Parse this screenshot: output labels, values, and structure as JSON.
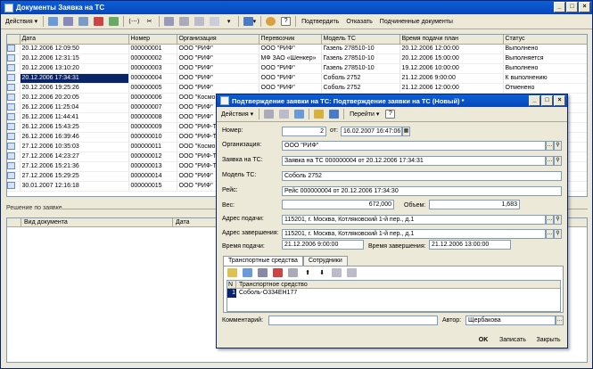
{
  "main": {
    "title": "Документы Заявка на ТС",
    "toolbar": {
      "actions_label": "Действия",
      "confirm_label": "Подтвердить",
      "refuse_label": "Отказать",
      "subordinate_label": "Подчиненные документы"
    },
    "columns": [
      "Дата",
      "Номер",
      "Организация",
      "Перевозчик",
      "Модель ТС",
      "Время подачи план",
      "Статус"
    ],
    "rows": [
      {
        "date": "20.12.2006 12:09:50",
        "num": "000000001",
        "org": "ООО \"РИФ\"",
        "carrier": "ООО \"РИФ\"",
        "model": "Газель 278510-10",
        "time": "20.12.2006 12:00:00",
        "status": "Выполнено"
      },
      {
        "date": "20.12.2006 12:31:15",
        "num": "000000002",
        "org": "ООО \"РИФ\"",
        "carrier": "МФ ЗАО «Шенкер»",
        "model": "Газель 278510-10",
        "time": "20.12.2006 15:00:00",
        "status": "Выполняется"
      },
      {
        "date": "20.12.2006 13:10:20",
        "num": "000000003",
        "org": "ООО \"РИФ\"",
        "carrier": "ООО \"РИФ\"",
        "model": "Газель 278510-10",
        "time": "19.12.2006 10:00:00",
        "status": "Выполнено"
      },
      {
        "date": "20.12.2006 17:34:31",
        "num": "000000004",
        "org": "ООО \"РИФ\"",
        "carrier": "ООО \"РИФ\"",
        "model": "Соболь 2752",
        "time": "21.12.2006 9:00:00",
        "status": "К выполнению"
      },
      {
        "date": "20.12.2006 19:25:26",
        "num": "000000005",
        "org": "ООО \"РИФ\"",
        "carrier": "ООО \"РИФ\"",
        "model": "Соболь 2752",
        "time": "21.12.2006 12:00:00",
        "status": "Отменено"
      },
      {
        "date": "20.12.2006 20:20:05",
        "num": "000000006",
        "org": "ООО \"Космо",
        "carrier": "",
        "model": "",
        "time": "",
        "status": ""
      },
      {
        "date": "26.12.2006 11:25:04",
        "num": "000000007",
        "org": "ООО \"РИФ\"",
        "carrier": "",
        "model": "",
        "time": "",
        "status": ""
      },
      {
        "date": "26.12.2006 11:44:41",
        "num": "000000008",
        "org": "ООО \"РИФ\"",
        "carrier": "",
        "model": "",
        "time": "",
        "status": ""
      },
      {
        "date": "26.12.2006 15:43:25",
        "num": "000000009",
        "org": "ООО \"РИФ-Т",
        "carrier": "",
        "model": "",
        "time": "",
        "status": ""
      },
      {
        "date": "26.12.2006 16:39:46",
        "num": "000000010",
        "org": "ООО \"РИФ-Т",
        "carrier": "",
        "model": "",
        "time": "",
        "status": ""
      },
      {
        "date": "27.12.2006 10:35:03",
        "num": "000000011",
        "org": "ООО \"Космо",
        "carrier": "",
        "model": "",
        "time": "",
        "status": ""
      },
      {
        "date": "27.12.2006 14:23:27",
        "num": "000000012",
        "org": "ООО \"РИФ-Т",
        "carrier": "",
        "model": "",
        "time": "",
        "status": ""
      },
      {
        "date": "27.12.2006 15:21:36",
        "num": "000000013",
        "org": "ООО \"РИФ-Т",
        "carrier": "",
        "model": "",
        "time": "",
        "status": ""
      },
      {
        "date": "27.12.2006 15:29:25",
        "num": "000000014",
        "org": "ООО \"РИФ\"",
        "carrier": "",
        "model": "",
        "time": "",
        "status": ""
      },
      {
        "date": "30.01.2007 12:16:18",
        "num": "000000015",
        "org": "ООО \"РИФ\"",
        "carrier": "",
        "model": "",
        "time": "",
        "status": ""
      }
    ],
    "decision": {
      "title": "Решение по заявке",
      "columns": [
        "Вид документа",
        "Дата"
      ]
    }
  },
  "dialog": {
    "title": "Подтверждение заявки на ТС: Подтверждение заявки на ТС (Новый) *",
    "toolbar": {
      "actions_label": "Действия",
      "goto_label": "Перейти"
    },
    "number_label": "Номер:",
    "number_value": "2",
    "from_label": "от:",
    "date_value": "16.02.2007 16:47:06",
    "org_label": "Организация:",
    "org_value": "ООО \"РИФ\"",
    "request_label": "Заявка на ТС:",
    "request_value": "Заявка на ТС 000000004 от 20.12.2006 17:34:31",
    "model_label": "Модель ТС:",
    "model_value": "Соболь 2752",
    "trip_label": "Рейс:",
    "trip_value": "Рейс 000000004 от 20.12.2006 17:34:30",
    "weight_label": "Вес:",
    "weight_value": "672,000",
    "volume_label": "Объем:",
    "volume_value": "1,683",
    "from_addr_label": "Адрес подачи:",
    "from_addr_value": "115201, г. Москва, Котляковский 1-й пер., д.1",
    "to_addr_label": "Адрес завершения:",
    "to_addr_value": "115201, г. Москва, Котляковский 1-й пер., д.1",
    "start_time_label": "Время подачи:",
    "start_time_value": "21.12.2006  9:00:00",
    "end_time_label": "Время завершения:",
    "end_time_value": "21.12.2006 13:00:00",
    "tabs": [
      "Транспортные средства",
      "Сотрудники"
    ],
    "grid_col_n": "N",
    "grid_col_vehicle": "Транспортное средство",
    "grid_row_n": "1",
    "grid_row_vehicle": "Соболь-О334ЕН177",
    "comment_label": "Комментарий:",
    "comment_value": "",
    "author_label": "Автор:",
    "author_value": "Щербакова",
    "ok_label": "OK",
    "save_label": "Записать",
    "close_label": "Закрыть"
  },
  "colors": {
    "title_bar": "#0846b8",
    "selection": "#0a246a",
    "window_bg": "#ece9d8"
  }
}
